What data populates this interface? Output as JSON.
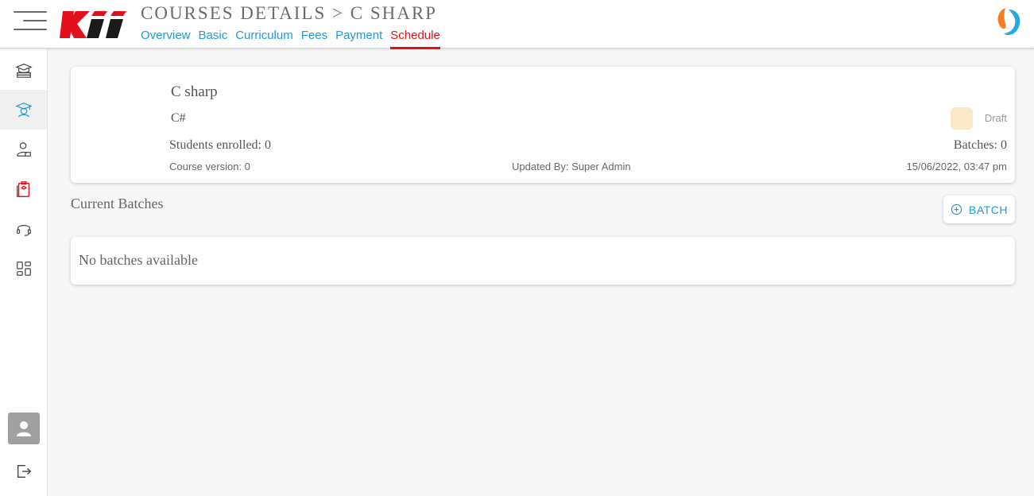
{
  "header": {
    "title": "COURSES DETAILS > C SHARP",
    "logo_text": "Kii",
    "tabs": [
      {
        "label": "Overview"
      },
      {
        "label": "Basic"
      },
      {
        "label": "Curriculum"
      },
      {
        "label": "Fees"
      },
      {
        "label": "Payment"
      },
      {
        "label": "Schedule",
        "active": true
      }
    ]
  },
  "sidebar": {
    "items": [
      {
        "icon": "course-stack-icon"
      },
      {
        "icon": "graduate-icon",
        "active": true
      },
      {
        "icon": "user-badge-icon"
      },
      {
        "icon": "clipboard-icon"
      },
      {
        "icon": "headset-icon"
      },
      {
        "icon": "grid-apps-icon"
      }
    ],
    "bottom": [
      {
        "icon": "user-avatar-icon"
      },
      {
        "icon": "logout-icon"
      }
    ]
  },
  "course": {
    "name": "C sharp",
    "code": "C#",
    "students_enrolled": "Students enrolled: 0",
    "version": "Course version: 0",
    "updated_by": "Updated By: Super Admin",
    "updated_at": "15/06/2022, 03:47 pm",
    "batches": "Batches: 0",
    "status": "Draft"
  },
  "batches_section": {
    "title": "Current Batches",
    "add_button": "BATCH",
    "empty_message": "No batches available"
  },
  "colors": {
    "accent_blue": "#1e9ad6",
    "active_red": "#e3101c",
    "draft_swatch": "#fbe8c6"
  }
}
